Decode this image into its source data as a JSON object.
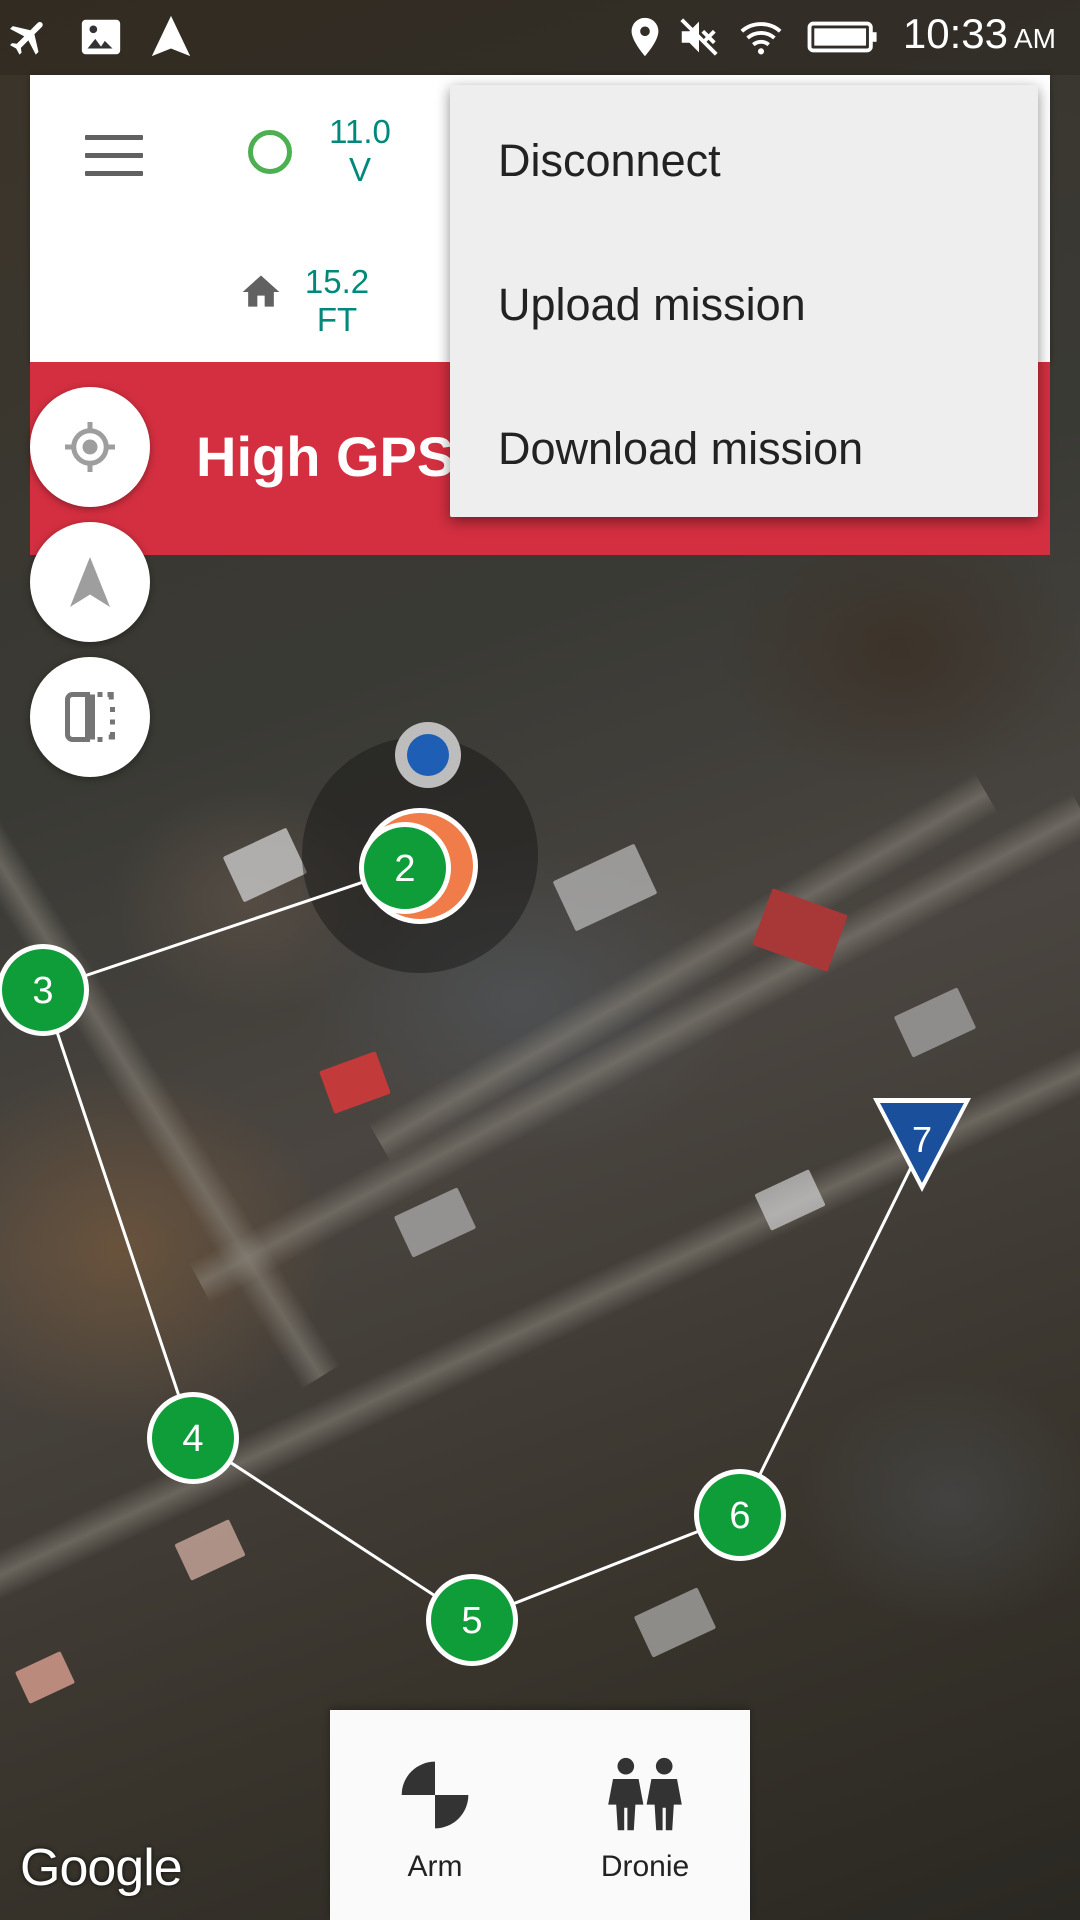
{
  "status_bar": {
    "time": "10:33",
    "ampm": "AM",
    "icons": [
      "airplane-mode-icon",
      "gallery-notification-icon",
      "navigation-notification-icon",
      "location-icon",
      "sound-muted-icon",
      "wifi-icon",
      "battery-icon"
    ]
  },
  "telemetry": {
    "battery_voltage_value": "11.0",
    "battery_voltage_unit": "V",
    "home_distance_value": "15.2",
    "home_distance_unit": "FT"
  },
  "alert": {
    "message": "High GPS H"
  },
  "overflow_menu": {
    "items": [
      "Disconnect",
      "Upload mission",
      "Download mission"
    ]
  },
  "mission": {
    "waypoints": [
      "2",
      "3",
      "4",
      "5",
      "6",
      "7"
    ]
  },
  "bottom_actions": {
    "arm_label": "Arm",
    "dronie_label": "Dronie"
  },
  "map": {
    "attribution": "Google"
  },
  "colors": {
    "alert_red": "#d32f40",
    "telemetry_teal": "#00897b",
    "waypoint_green": "#0f9d3a",
    "land_marker_blue": "#1a4f9c",
    "drone_orange": "#f07c4a"
  }
}
